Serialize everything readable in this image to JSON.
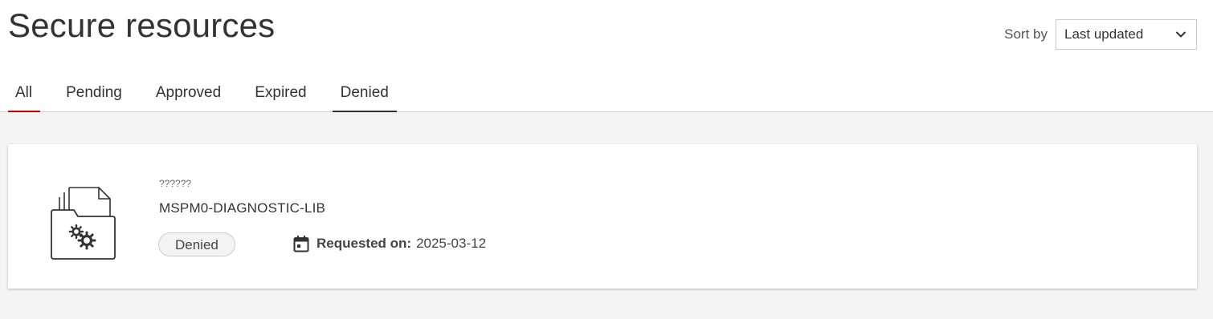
{
  "page": {
    "title": "Secure resources"
  },
  "sort": {
    "label": "Sort by",
    "selected": "Last updated",
    "icon": "chevron-down-icon"
  },
  "tabs": [
    {
      "label": "All",
      "active": true
    },
    {
      "label": "Pending",
      "active": false
    },
    {
      "label": "Approved",
      "active": false
    },
    {
      "label": "Expired",
      "active": false
    },
    {
      "label": "Denied",
      "active": false
    }
  ],
  "colors": {
    "accent": "#cc0000",
    "background": "#f4f4f4",
    "card": "#ffffff"
  },
  "resources": [
    {
      "icon": "folder-gears-icon",
      "subtitle": "??????",
      "name": "MSPM0-DIAGNOSTIC-LIB",
      "status": "Denied",
      "requested_label": "Requested on:",
      "requested_date": "2025-03-12",
      "date_icon": "calendar-icon"
    }
  ]
}
